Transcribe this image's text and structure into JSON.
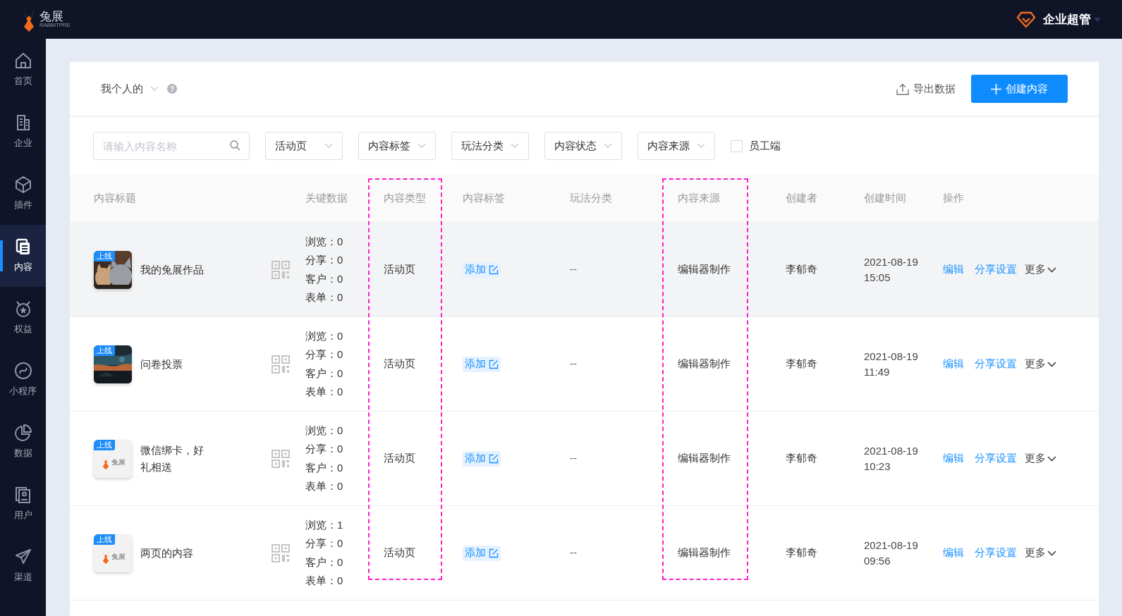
{
  "topbar": {
    "logo_text": "兔展",
    "logo_subtext": "RABBITPRE",
    "user": "企业超管"
  },
  "sidebar": {
    "items": [
      {
        "label": "首页",
        "selected": false
      },
      {
        "label": "企业",
        "selected": false
      },
      {
        "label": "插件",
        "selected": false
      },
      {
        "label": "内容",
        "selected": true
      },
      {
        "label": "权益",
        "selected": false
      },
      {
        "label": "小程序",
        "selected": false
      },
      {
        "label": "数据",
        "selected": false
      },
      {
        "label": "用户",
        "selected": false
      },
      {
        "label": "渠道",
        "selected": false
      }
    ]
  },
  "header": {
    "scope": "我个人的",
    "help": "?",
    "export": "导出数据",
    "create": "创建内容"
  },
  "filters": {
    "search_placeholder": "请输入内容名称",
    "selects": [
      "活动页",
      "内容标签",
      "玩法分类",
      "内容状态",
      "内容来源"
    ],
    "checkbox": {
      "label": "员工端",
      "checked": false
    }
  },
  "table": {
    "columns": [
      {
        "label": "内容标题",
        "highlighted": false
      },
      {
        "label": "关键数据",
        "highlighted": false
      },
      {
        "label": "内容类型",
        "highlighted": true
      },
      {
        "label": "内容标签",
        "highlighted": false
      },
      {
        "label": "玩法分类",
        "highlighted": false
      },
      {
        "label": "内容来源",
        "highlighted": true
      },
      {
        "label": "创建者",
        "highlighted": false
      },
      {
        "label": "创建时间",
        "highlighted": false
      },
      {
        "label": "操作",
        "highlighted": false
      }
    ],
    "rows": [
      {
        "hovered": true,
        "thumb": {
          "kind": "cats",
          "badge": "上线"
        },
        "title": "我的兔展作品",
        "stats": [
          "浏览：0",
          "分享：0",
          "客户：0",
          "表单：0"
        ],
        "type": "活动页",
        "tag": "添加",
        "play": "--",
        "source": "编辑器制作",
        "creator": "李郁奇",
        "created": "2021-08-19 15:05",
        "actions": [
          "编辑",
          "分享设置"
        ],
        "more": "更多"
      },
      {
        "hovered": false,
        "thumb": {
          "kind": "dusk",
          "badge": "上线"
        },
        "title": "问卷投票",
        "stats": [
          "浏览：0",
          "分享：0",
          "客户：0",
          "表单：0"
        ],
        "type": "活动页",
        "tag": "添加",
        "play": "--",
        "source": "编辑器制作",
        "creator": "李郁奇",
        "created": "2021-08-19 11:49",
        "actions": [
          "编辑",
          "分享设置"
        ],
        "more": "更多"
      },
      {
        "hovered": false,
        "thumb": {
          "kind": "logo",
          "badge": "上线",
          "text": "兔展"
        },
        "title": "微信绑卡，好礼相送",
        "stats": [
          "浏览：0",
          "分享：0",
          "客户：0",
          "表单：0"
        ],
        "type": "活动页",
        "tag": "添加",
        "play": "--",
        "source": "编辑器制作",
        "creator": "李郁奇",
        "created": "2021-08-19 10:23",
        "actions": [
          "编辑",
          "分享设置"
        ],
        "more": "更多"
      },
      {
        "hovered": false,
        "thumb": {
          "kind": "logo",
          "badge": "上线",
          "text": "兔展"
        },
        "title": "两页的内容",
        "stats": [
          "浏览：1",
          "分享：0",
          "客户：0",
          "表单：0"
        ],
        "type": "活动页",
        "tag": "添加",
        "play": "--",
        "source": "编辑器制作",
        "creator": "李郁奇",
        "created": "2021-08-19 09:56",
        "actions": [
          "编辑",
          "分享设置"
        ],
        "more": "更多"
      }
    ]
  }
}
